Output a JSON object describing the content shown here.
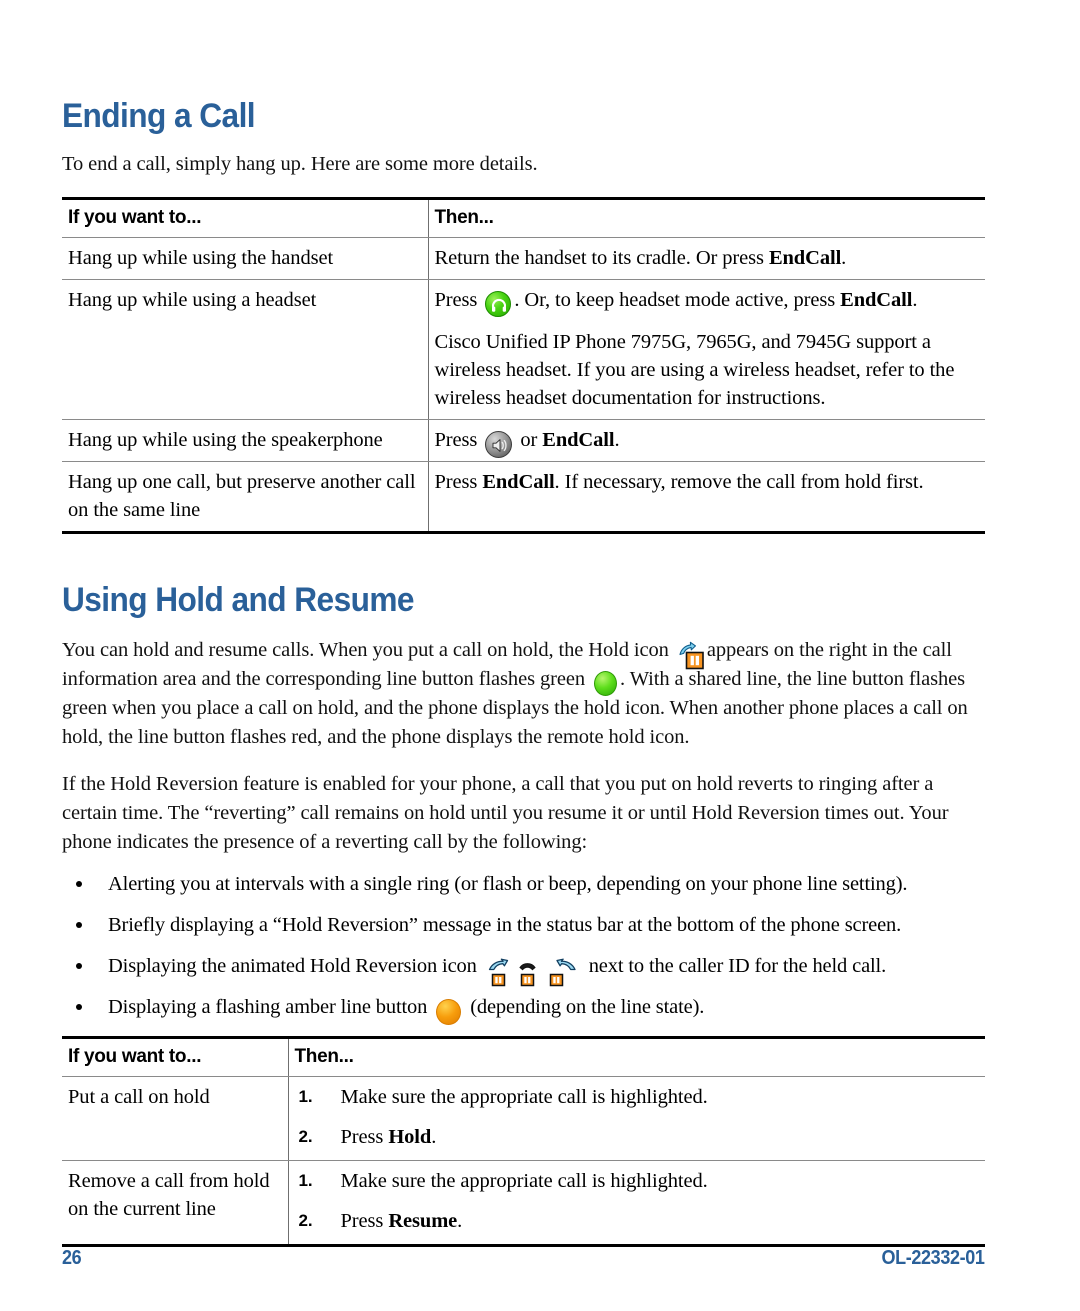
{
  "page": {
    "number": "26",
    "doc_id": "OL-22332-01",
    "heading_color": "#2A6099"
  },
  "section1": {
    "heading": "Ending a Call",
    "intro": "To end a call, simply hang up. Here are some more details.",
    "table": {
      "headers": [
        "If you want to...",
        "Then..."
      ],
      "rows": [
        {
          "want": "Hang up while using the handset",
          "then_parts": [
            {
              "type": "text",
              "value": "Return the handset to its cradle. Or press "
            },
            {
              "type": "bold",
              "value": "EndCall"
            },
            {
              "type": "text",
              "value": "."
            }
          ]
        },
        {
          "want": "Hang up while using a headset",
          "then_parts": [
            {
              "type": "text",
              "value": "Press "
            },
            {
              "type": "icon",
              "value": "headset-button-icon"
            },
            {
              "type": "text",
              "value": ". Or, to keep headset mode active, press "
            },
            {
              "type": "bold",
              "value": "EndCall"
            },
            {
              "type": "text",
              "value": "."
            }
          ],
          "then_extra": "Cisco Unified IP Phone 7975G, 7965G, and 7945G support a wireless headset. If you are using a wireless headset, refer to the wireless headset documentation for instructions."
        },
        {
          "want": "Hang up while using the speakerphone",
          "then_parts": [
            {
              "type": "text",
              "value": "Press "
            },
            {
              "type": "icon",
              "value": "speakerphone-button-icon"
            },
            {
              "type": "text",
              "value": " or "
            },
            {
              "type": "bold",
              "value": "EndCall"
            },
            {
              "type": "text",
              "value": "."
            }
          ]
        },
        {
          "want": "Hang up one call, but preserve another call on the same line",
          "then_parts": [
            {
              "type": "text",
              "value": "Press "
            },
            {
              "type": "bold",
              "value": "EndCall"
            },
            {
              "type": "text",
              "value": ". If necessary, remove the call from hold first."
            }
          ]
        }
      ]
    }
  },
  "section2": {
    "heading": "Using Hold and Resume",
    "para1_parts": [
      {
        "type": "text",
        "value": "You can hold and resume calls. When you put a call on hold, the Hold icon "
      },
      {
        "type": "icon",
        "value": "hold-icon"
      },
      {
        "type": "text",
        "value": "appears on the right in the call information area and the corresponding line button flashes green "
      },
      {
        "type": "icon",
        "value": "green-line-button-icon"
      },
      {
        "type": "text",
        "value": ". With a shared line, the line button flashes green when you place a call on hold, and the phone displays the hold icon. When another phone places a call on hold, the line button flashes red, and the phone displays the remote hold icon."
      }
    ],
    "para2": "If the Hold Reversion feature is enabled for your phone, a call that you put on hold reverts to ringing after a certain time. The “reverting” call remains on hold until you resume it or until Hold Reversion times out. Your phone indicates the presence of a reverting call by the following:",
    "bullets": [
      {
        "parts": [
          {
            "type": "text",
            "value": "Alerting you at intervals with a single ring (or flash or beep, depending on your phone line setting)."
          }
        ]
      },
      {
        "parts": [
          {
            "type": "text",
            "value": "Briefly displaying a “Hold Reversion” message in the status bar at the bottom of the phone screen."
          }
        ]
      },
      {
        "parts": [
          {
            "type": "text",
            "value": "Displaying the animated Hold Reversion icon "
          },
          {
            "type": "icon",
            "value": "hold-reversion-animated-icon"
          },
          {
            "type": "text",
            "value": " next to the caller ID for the held call."
          }
        ]
      },
      {
        "parts": [
          {
            "type": "text",
            "value": "Displaying a flashing amber line button "
          },
          {
            "type": "icon",
            "value": "amber-line-button-icon"
          },
          {
            "type": "text",
            "value": " (depending on the line state)."
          }
        ]
      }
    ],
    "table": {
      "headers": [
        "If you want to...",
        "Then..."
      ],
      "rows": [
        {
          "want": "Put a call on hold",
          "steps": [
            {
              "num": "1.",
              "parts": [
                {
                  "type": "text",
                  "value": "Make sure the appropriate call is highlighted."
                }
              ]
            },
            {
              "num": "2.",
              "parts": [
                {
                  "type": "text",
                  "value": "Press "
                },
                {
                  "type": "bold",
                  "value": "Hold"
                },
                {
                  "type": "text",
                  "value": "."
                }
              ]
            }
          ]
        },
        {
          "want": "Remove a call from hold on the current line",
          "steps": [
            {
              "num": "1.",
              "parts": [
                {
                  "type": "text",
                  "value": "Make sure the appropriate call is highlighted."
                }
              ]
            },
            {
              "num": "2.",
              "parts": [
                {
                  "type": "text",
                  "value": "Press "
                },
                {
                  "type": "bold",
                  "value": "Resume"
                },
                {
                  "type": "text",
                  "value": "."
                }
              ]
            }
          ]
        }
      ]
    }
  },
  "icons": {
    "headset-button-icon": "headset-button-icon",
    "speakerphone-button-icon": "speakerphone-button-icon",
    "hold-icon": "hold-icon",
    "green-line-button-icon": "green-line-button-icon",
    "amber-line-button-icon": "amber-line-button-icon",
    "hold-reversion-animated-icon": "hold-reversion-animated-icon"
  }
}
